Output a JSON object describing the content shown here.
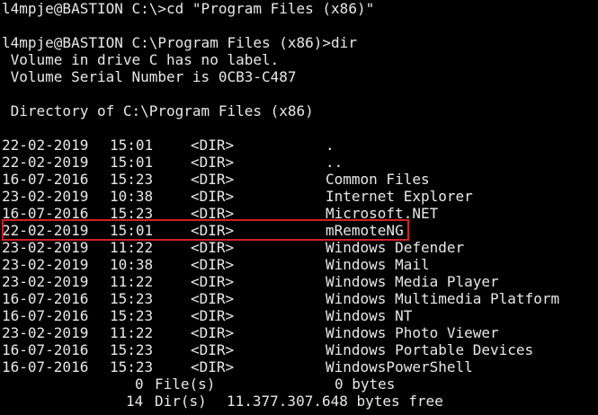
{
  "header": {
    "cmd1": "l4mpje@BASTION C:\\>cd \"Program Files (x86)\"",
    "cmd2": "l4mpje@BASTION C:\\Program Files (x86)>dir",
    "volume_label": " Volume in drive C has no label.",
    "volume_serial": " Volume Serial Number is 0CB3-C487",
    "directory_of": " Directory of C:\\Program Files (x86)"
  },
  "listing": [
    {
      "date": "22-02-2019",
      "time": "15:01",
      "type": "<DIR>",
      "name": "."
    },
    {
      "date": "22-02-2019",
      "time": "15:01",
      "type": "<DIR>",
      "name": ".."
    },
    {
      "date": "16-07-2016",
      "time": "15:23",
      "type": "<DIR>",
      "name": "Common Files"
    },
    {
      "date": "23-02-2019",
      "time": "10:38",
      "type": "<DIR>",
      "name": "Internet Explorer"
    },
    {
      "date": "16-07-2016",
      "time": "15:23",
      "type": "<DIR>",
      "name": "Microsoft.NET"
    },
    {
      "date": "22-02-2019",
      "time": "15:01",
      "type": "<DIR>",
      "name": "mRemoteNG"
    },
    {
      "date": "23-02-2019",
      "time": "11:22",
      "type": "<DIR>",
      "name": "Windows Defender"
    },
    {
      "date": "23-02-2019",
      "time": "10:38",
      "type": "<DIR>",
      "name": "Windows Mail"
    },
    {
      "date": "23-02-2019",
      "time": "11:22",
      "type": "<DIR>",
      "name": "Windows Media Player"
    },
    {
      "date": "16-07-2016",
      "time": "15:23",
      "type": "<DIR>",
      "name": "Windows Multimedia Platform"
    },
    {
      "date": "16-07-2016",
      "time": "15:23",
      "type": "<DIR>",
      "name": "Windows NT"
    },
    {
      "date": "23-02-2019",
      "time": "11:22",
      "type": "<DIR>",
      "name": "Windows Photo Viewer"
    },
    {
      "date": "16-07-2016",
      "time": "15:23",
      "type": "<DIR>",
      "name": "Windows Portable Devices"
    },
    {
      "date": "16-07-2016",
      "time": "15:23",
      "type": "<DIR>",
      "name": "WindowsPowerShell"
    }
  ],
  "summary": {
    "files_count": "0",
    "files_label": "File(s)",
    "files_bytes": "0 bytes",
    "dirs_count": "14",
    "dirs_label": "Dir(s)",
    "dirs_bytes": "11.377.307.648 bytes free"
  },
  "highlight": {
    "row_name": "mRemoteNG",
    "color": "#d42020"
  },
  "colors": {
    "background": "#000000",
    "text": "#e8e8e8"
  }
}
